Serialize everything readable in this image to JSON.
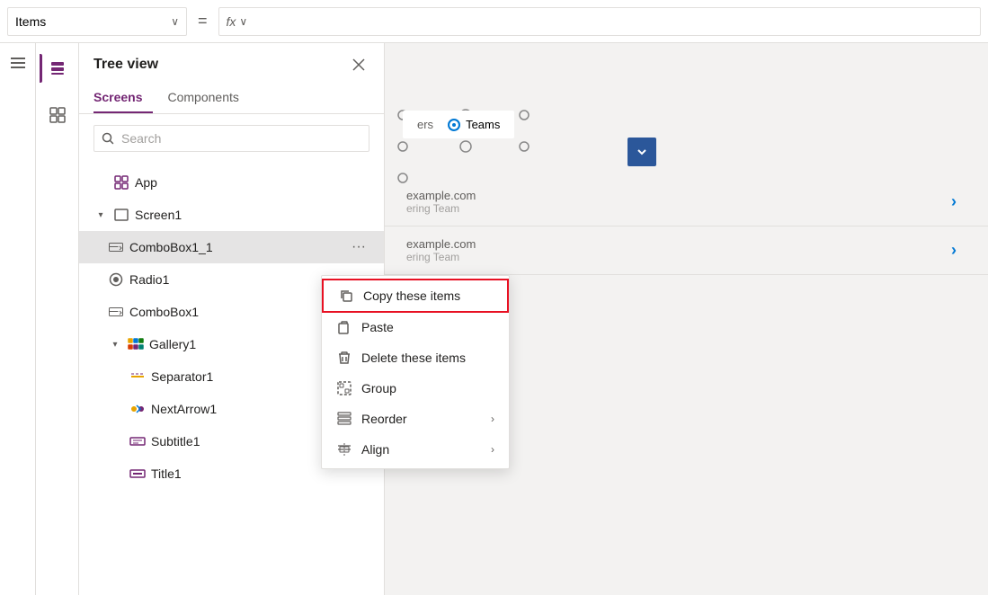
{
  "topbar": {
    "items_label": "Items",
    "dropdown_arrow": "∨",
    "equals": "=",
    "fx_label": "fx",
    "fx_arrow": "∨"
  },
  "treeview": {
    "title": "Tree view",
    "close_label": "×",
    "tabs": [
      {
        "label": "Screens",
        "active": true
      },
      {
        "label": "Components",
        "active": false
      }
    ],
    "search_placeholder": "Search",
    "items": [
      {
        "id": "app",
        "label": "App",
        "indent": 0,
        "type": "app",
        "has_expand": false
      },
      {
        "id": "screen1",
        "label": "Screen1",
        "indent": 0,
        "type": "screen",
        "has_expand": true,
        "expanded": true
      },
      {
        "id": "combobox1_1",
        "label": "ComboBox1_1",
        "indent": 1,
        "type": "combobox",
        "selected": true
      },
      {
        "id": "radio1",
        "label": "Radio1",
        "indent": 1,
        "type": "radio"
      },
      {
        "id": "combobox1",
        "label": "ComboBox1",
        "indent": 1,
        "type": "combobox"
      },
      {
        "id": "gallery1",
        "label": "Gallery1",
        "indent": 1,
        "type": "gallery",
        "has_expand": true,
        "expanded": true
      },
      {
        "id": "separator1",
        "label": "Separator1",
        "indent": 2,
        "type": "separator"
      },
      {
        "id": "nextarrow1",
        "label": "NextArrow1",
        "indent": 2,
        "type": "nextarrow"
      },
      {
        "id": "subtitle1",
        "label": "Subtitle1",
        "indent": 2,
        "type": "subtitle"
      },
      {
        "id": "title1",
        "label": "Title1",
        "indent": 2,
        "type": "title"
      }
    ]
  },
  "context_menu": {
    "items": [
      {
        "label": "Copy these items",
        "icon": "copy",
        "has_arrow": false,
        "highlighted": true
      },
      {
        "label": "Paste",
        "icon": "paste",
        "has_arrow": false
      },
      {
        "label": "Delete these items",
        "icon": "delete",
        "has_arrow": false
      },
      {
        "label": "Group",
        "icon": "group",
        "has_arrow": false
      },
      {
        "label": "Reorder",
        "icon": "reorder",
        "has_arrow": true
      },
      {
        "label": "Align",
        "icon": "align",
        "has_arrow": true
      }
    ]
  },
  "canvas": {
    "radio_label": "Teams",
    "list_items": [
      {
        "title": "example.com",
        "subtitle": "ering Team"
      },
      {
        "title": "example.com",
        "subtitle": "ering Team"
      }
    ]
  }
}
